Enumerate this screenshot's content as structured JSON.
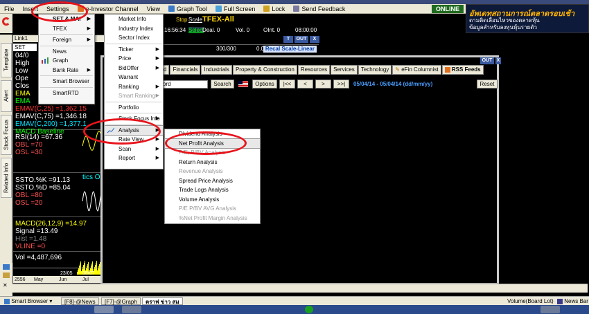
{
  "menubar": {
    "items": [
      "File",
      "Insert",
      "Settings",
      "e-Investor Channel",
      "View",
      "Graph Tool",
      "Full Screen",
      "Lock",
      "Send Feedback"
    ],
    "online": "ONLINE"
  },
  "banner": {
    "line1": "อัพเดทสถานการณ์ตลาดรอบเช้า",
    "line2": "ตามติดเลื่อนไหวของตลาดหุ้น",
    "line3": "ข้อมูลสำหรับลงทุนหุ้นรายตัว"
  },
  "left_tabs": [
    "Template",
    "Alert",
    "Stock Focus",
    "Related Info"
  ],
  "chart": {
    "symbol_tab": "Link1",
    "symbol": "SET",
    "lines": [
      {
        "text": "04/0",
        "color": "#ffffff"
      },
      {
        "text": "High",
        "color": "#ffffff"
      },
      {
        "text": "Low",
        "color": "#ffffff"
      },
      {
        "text": "Ope",
        "color": "#ffffff"
      },
      {
        "text": "Clos",
        "color": "#ffffff"
      },
      {
        "text": "EMA",
        "color": "#ffff00"
      },
      {
        "text": "EMA",
        "color": "#00ff00"
      },
      {
        "text": "EMAV(C,25) =1,362.15",
        "color": "#ff3030"
      },
      {
        "text": "EMAV(C,75) =1,346.18",
        "color": "#ffffff"
      },
      {
        "text": "EMAV(C,200) =1,377.1",
        "color": "#00e5ff"
      },
      {
        "text": "MACD Baseline",
        "color": "#00ff00"
      }
    ],
    "rsi": {
      "line1": "RSI(14) =67.36",
      "line2": "OBL =70",
      "line3": "OSL =30"
    },
    "stoch": {
      "line1": "SSTO.%K =91.13",
      "line2": "SSTO.%D =85.04",
      "line3": "OBL =80",
      "line4": "OSL =20",
      "side": "tics O"
    },
    "macd": {
      "line1": "MACD(26,12,9) =14.97",
      "line2": "Signal =13.49",
      "line3": "Hist =1.48",
      "line4": "VLINE =0"
    },
    "vol": "Vol =4,487,696",
    "dates": [
      "2556",
      "May",
      "Jun",
      "Jul"
    ],
    "date_labels": [
      "23/05",
      "08/07"
    ]
  },
  "tfex": {
    "stop_label": "Stop",
    "scale_label": "Scale",
    "title": "TFEX-All",
    "time": "16:56:34",
    "select_label": "Select",
    "deal": "Deal. 0",
    "vol": "Vol. 0",
    "oint": "OInt. 0",
    "clock": "08:00:00",
    "count": "300/300",
    "value": "0.00",
    "recal": "Recal Scale-Linear",
    "ctl_t": "T",
    "ctl_out": "OUT",
    "ctl_x": "X"
  },
  "mainwin": {
    "out": "OUT",
    "x": "X",
    "tabs": [
      "d",
      "Financials",
      "Industrials",
      "Property & Construction",
      "Resources",
      "Services",
      "Technology",
      "eFin Columnist",
      "RSS Feeds"
    ],
    "search_placeholder": "ord",
    "search_btn": "Search",
    "options_btn": "Options",
    "nav": [
      "|<<",
      "<",
      ">",
      ">>|"
    ],
    "daterange": "05/04/14 - 05/04/14 (dd/mm/yy)",
    "reset_btn": "Reset"
  },
  "menu_insert": {
    "items": [
      {
        "label": "SET & MAI",
        "arrow": true,
        "bold": true
      },
      {
        "label": "TFEX",
        "arrow": true
      },
      {
        "label": "Foreign",
        "arrow": true
      },
      {
        "label": "News"
      },
      {
        "label": "Graph"
      },
      {
        "label": "Bank Rate",
        "arrow": true
      },
      {
        "label": "Smart Browser"
      },
      {
        "label": "SmartRTD"
      }
    ]
  },
  "menu_set": {
    "items": [
      {
        "label": "Market Info"
      },
      {
        "label": "Industry Index"
      },
      {
        "label": "Sector Index"
      },
      {
        "label": "Ticker",
        "arrow": true
      },
      {
        "label": "Price",
        "arrow": true
      },
      {
        "label": "BidOffer",
        "arrow": true
      },
      {
        "label": "Warrant"
      },
      {
        "label": "Ranking",
        "arrow": true
      },
      {
        "label": "Smart Ranking",
        "arrow": true,
        "disabled": true
      },
      {
        "label": "Portfolio"
      },
      {
        "label": "Stock Focus Info",
        "arrow": true
      },
      {
        "label": "Analysis",
        "arrow": true,
        "highlight": true
      },
      {
        "label": "Rate View",
        "arrow": true
      },
      {
        "label": "Scan",
        "arrow": true
      },
      {
        "label": "Report",
        "arrow": true
      }
    ]
  },
  "menu_analysis": {
    "items": [
      {
        "label": "Dividend Analysis"
      },
      {
        "label": "Net Profit Analysis",
        "highlight": true
      },
      {
        "label": "P/E, P/BV Analysis",
        "disabled": true
      },
      {
        "label": "Return Analysis"
      },
      {
        "label": "Revenue Analysis",
        "disabled": true
      },
      {
        "label": "Spread Price Analysis"
      },
      {
        "label": "Trade Logs Analysis"
      },
      {
        "label": "Volume Analysis"
      },
      {
        "label": "P/E P/BV AVG Analysis",
        "disabled": true
      },
      {
        "label": "%Net Profit Margin Analysis",
        "disabled": true
      }
    ]
  },
  "statusbar": {
    "smart_browser": "Smart Browser",
    "f8": "[F8]-@News",
    "f7": "[F7]-@Graph",
    "tab3": "ตราฟ ข่าว สม",
    "volume": "Volume(Board Lot)",
    "newsbar": "News Bar"
  },
  "colors": {
    "highlight_ring": "#e8141c",
    "menu_bg": "#ffffff",
    "date_blue": "#4a9eff"
  }
}
